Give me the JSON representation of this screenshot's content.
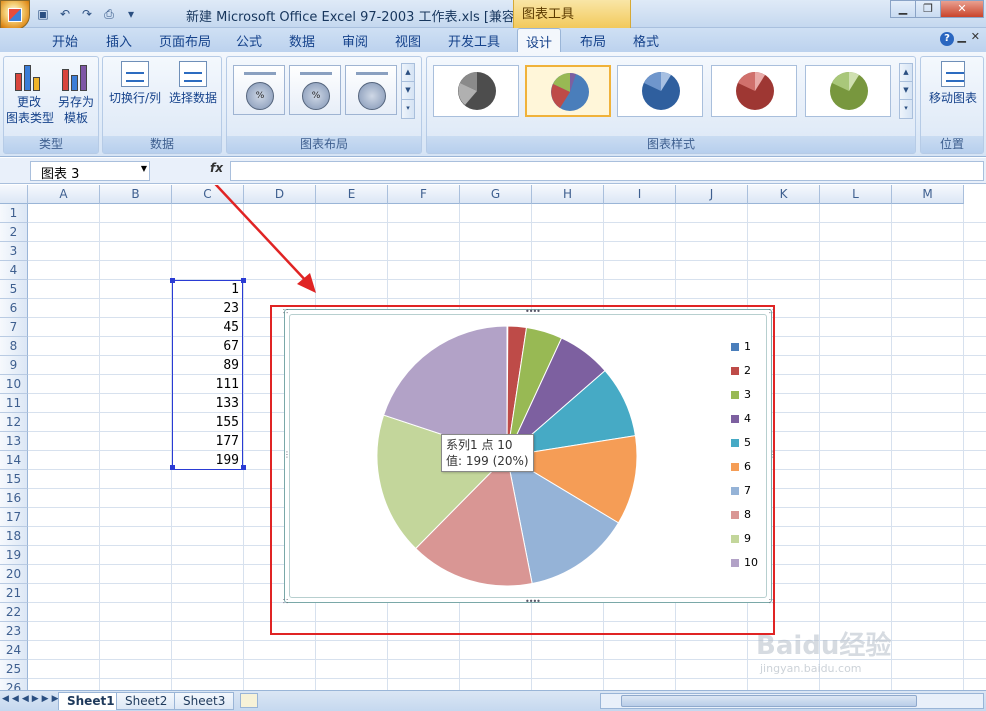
{
  "window": {
    "title": "新建 Microsoft Office Excel 97-2003 工作表.xls  [兼容...",
    "chart_tools_label": "图表工具"
  },
  "tabs": [
    {
      "label": "开始"
    },
    {
      "label": "插入"
    },
    {
      "label": "页面布局"
    },
    {
      "label": "公式"
    },
    {
      "label": "数据"
    },
    {
      "label": "审阅"
    },
    {
      "label": "视图"
    },
    {
      "label": "开发工具"
    },
    {
      "label": "设计",
      "active": true
    },
    {
      "label": "布局"
    },
    {
      "label": "格式"
    }
  ],
  "ribbon": {
    "type_group": {
      "label": "类型",
      "change_type": "更改\n图表类型",
      "save_template": "另存为\n模板"
    },
    "data_group": {
      "label": "数据",
      "switch_row_col": "切换行/列",
      "select_data": "选择数据"
    },
    "layout_group": {
      "label": "图表布局"
    },
    "style_group": {
      "label": "图表样式"
    },
    "location_group": {
      "label": "位置",
      "move_chart": "移动图表"
    }
  },
  "formula_bar": {
    "name_box": "图表 3",
    "fx": "fx"
  },
  "columns": [
    "A",
    "B",
    "C",
    "D",
    "E",
    "F",
    "G",
    "H",
    "I",
    "J",
    "K",
    "L",
    "M"
  ],
  "rows": [
    "1",
    "2",
    "3",
    "4",
    "5",
    "6",
    "7",
    "8",
    "9",
    "10",
    "11",
    "12",
    "13",
    "14",
    "15",
    "16",
    "17",
    "18",
    "19",
    "20",
    "21",
    "22",
    "23",
    "24",
    "25",
    "26"
  ],
  "cells_c": [
    "1",
    "23",
    "45",
    "67",
    "89",
    "111",
    "133",
    "155",
    "177",
    "199"
  ],
  "chart_data": {
    "type": "pie",
    "categories": [
      "1",
      "2",
      "3",
      "4",
      "5",
      "6",
      "7",
      "8",
      "9",
      "10"
    ],
    "values": [
      1,
      23,
      45,
      67,
      89,
      111,
      133,
      155,
      177,
      199
    ],
    "colors": [
      "#4a7ebb",
      "#be4b48",
      "#98b954",
      "#7d60a0",
      "#46aac5",
      "#f59d56",
      "#95b3d7",
      "#d99694",
      "#c3d69b",
      "#b2a2c7"
    ],
    "legend_position": "right",
    "tooltip": {
      "line1": "系列1 点 10",
      "line2": "值: 199 (20%)"
    }
  },
  "sheet_tabs": [
    "Sheet1",
    "Sheet2",
    "Sheet3"
  ],
  "watermark": {
    "text": "Baidu经验",
    "url": "jingyan.baidu.com"
  }
}
